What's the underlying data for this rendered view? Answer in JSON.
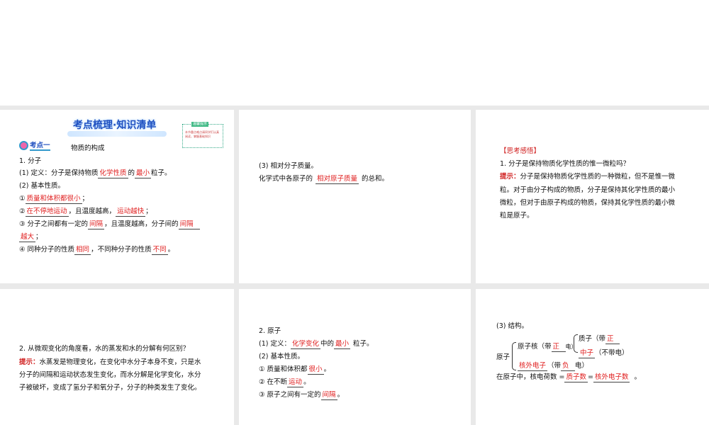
{
  "p1": {
    "title": "考点梳理·知识清单",
    "note_header": "温馨提示",
    "note_text": "本节重点难点请同学们认真阅读，掌握基础知识",
    "badge": "考点一",
    "topic": "物质的构成",
    "l1": "1. 分子",
    "l2a": "(1) 定义：分子是保持物质",
    "l2b": "化学性质",
    "l2c": "的",
    "l2d": "最小",
    "l2e": "粒子。",
    "l3": "(2) 基本性质。",
    "l4a": "①",
    "l4b": "质量和体积都很小",
    "l4c": "；",
    "l5a": "②",
    "l5b": "在不停地运动",
    "l5c": "，且温度越高，",
    "l5d": "运动越快",
    "l5e": "；",
    "l6a": "③ 分子之间都有一定的",
    "l6b": "间隔",
    "l6c": "，且温度越高，分子间的",
    "l6d": "间隔",
    "l7a": "越大",
    "l7b": "；",
    "l8a": "④ 同种分子的性质",
    "l8b": "相同",
    "l8c": "，不同种分子的性质",
    "l8d": "不同",
    "l8e": "。"
  },
  "p2": {
    "l1": "(3) 相对分子质量。",
    "l2a": "化学式中各原子的",
    "l2b": "相对原子质量",
    "l2c": "的总和。"
  },
  "p3": {
    "head": "【思考感悟】",
    "q": "1. 分子是保持物质化学性质的惟一微粒吗？",
    "hint": "提示：",
    "a1": "分子是保持物质化学性质的一种微粒，但不是惟一微",
    "a2": "粒。对于由分子构成的物质，分子是保持其化学性质的最小",
    "a3": "微粒，但对于由原子构成的物质，保持其化学性质的最小微",
    "a4": "粒是原子。"
  },
  "p4": {
    "q": "2. 从微观变化的角度看，水的蒸发和水的分解有何区别？",
    "hint": "提示：",
    "a1": "水蒸发是物理变化，在变化中水分子本身不变，只是水",
    "a2": "分子的间隔和运动状态发生变化，而水分解是化学变化，水分",
    "a3": "子被破坏，变成了氢分子和氧分子，分子的种类发生了变化。"
  },
  "p5": {
    "l1": "2. 原子",
    "l2a": "(1) 定义：",
    "l2b": "化学变化",
    "l2c": "中的",
    "l2d": "最小",
    "l2e": "粒子。",
    "l3": "(2) 基本性质。",
    "l4a": "① 质量和体积都",
    "l4b": "很小",
    "l4c": "。",
    "l5a": "② 在不断",
    "l5b": "运动",
    "l5c": "。",
    "l6a": "③ 原子之间有一定的",
    "l6b": "间隔",
    "l6c": "。"
  },
  "p6": {
    "l1": "(3) 结构。",
    "atom": "原子",
    "nuc": "原子核（带",
    "nuc_r": "正",
    "nuc_e": "电）",
    "pro": "质子（带",
    "pro_r": "正",
    "pro_e": "电）",
    "neu_r": "中子",
    "neu": "（不带电）",
    "ele_r": "核外电子",
    "ele": "（带",
    "ele_r2": "负",
    "ele_e": "电）",
    "eq1": "在原子中，核电荷数 =",
    "eq_r1": "质子数",
    "eq2": "=",
    "eq_r2": "核外电子数",
    "eq3": "。"
  }
}
